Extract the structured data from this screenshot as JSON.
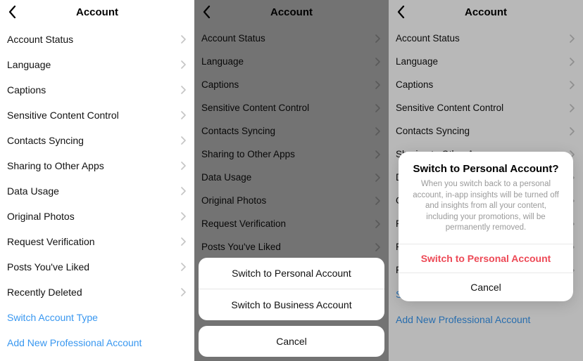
{
  "header": {
    "title": "Account"
  },
  "menu": {
    "items": [
      "Account Status",
      "Language",
      "Captions",
      "Sensitive Content Control",
      "Contacts Syncing",
      "Sharing to Other Apps",
      "Data Usage",
      "Original Photos",
      "Request Verification",
      "Posts You've Liked",
      "Recently Deleted"
    ],
    "links": [
      "Switch Account Type",
      "Add New Professional Account"
    ]
  },
  "sheet": {
    "options": [
      "Switch to Personal Account",
      "Switch to Business Account"
    ],
    "cancel": "Cancel"
  },
  "alert": {
    "title": "Switch to Personal Account?",
    "body": "When you switch back to a personal account, in-app insights will be turned off and insights from all your content, including your promotions, will be permanently removed.",
    "confirm": "Switch to Personal Account",
    "cancel": "Cancel"
  }
}
